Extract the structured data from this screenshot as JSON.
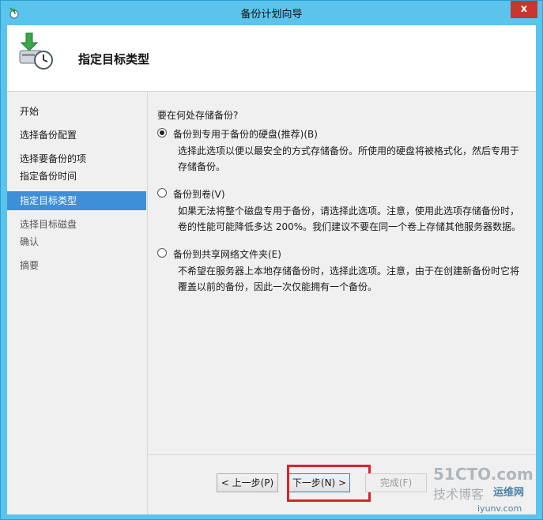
{
  "window": {
    "title": "备份计划向导",
    "close_glyph": "x"
  },
  "header": {
    "title": "指定目标类型",
    "icon": "backup-wizard-icon"
  },
  "nav": {
    "items": [
      {
        "label": "开始",
        "state": "normal"
      },
      {
        "label": "选择备份配置",
        "state": "normal"
      },
      {
        "label": "选择要备份的项",
        "state": "normal"
      },
      {
        "label": "指定备份时间",
        "state": "normal"
      },
      {
        "label": "指定目标类型",
        "state": "active"
      },
      {
        "label": "选择目标磁盘",
        "state": "disabled"
      },
      {
        "label": "确认",
        "state": "disabled"
      },
      {
        "label": "摘要",
        "state": "disabled"
      }
    ]
  },
  "content": {
    "question": "要在何处存储备份?",
    "options": [
      {
        "label": "备份到专用于备份的硬盘(推荐)(B)",
        "checked": true,
        "desc_line1": "选择此选项以便以最安全的方式存储备份。所使用的硬盘将被格式化，然后专用于",
        "desc_line2": "存储备份。"
      },
      {
        "label": "备份到卷(V)",
        "checked": false,
        "desc_line1": "如果无法将整个磁盘专用于备份，请选择此选项。注意，使用此选项存储备份时，",
        "desc_line2": "卷的性能可能降低多达 200%。我们建议不要在同一个卷上存储其他服务器数据。"
      },
      {
        "label": "备份到共享网络文件夹(E)",
        "checked": false,
        "desc_line1": "不希望在服务器上本地存储备份时，选择此选项。注意，由于在创建新备份时它将",
        "desc_line2": "覆盖以前的备份，因此一次仅能拥有一个备份。"
      }
    ]
  },
  "footer": {
    "prev_label": "< 上一步(P)",
    "next_label": "下一步(N) >",
    "finish_label": "完成(F)"
  },
  "watermark": {
    "line1": "51CTO.com",
    "line2": "技术博客",
    "line3": "iyunv.com",
    "line4": "运维网"
  },
  "colors": {
    "titlebar": "#5bc4ec",
    "nav_active": "#3e8fd8",
    "highlight": "#d9232a",
    "close_button": "#c7372f"
  }
}
